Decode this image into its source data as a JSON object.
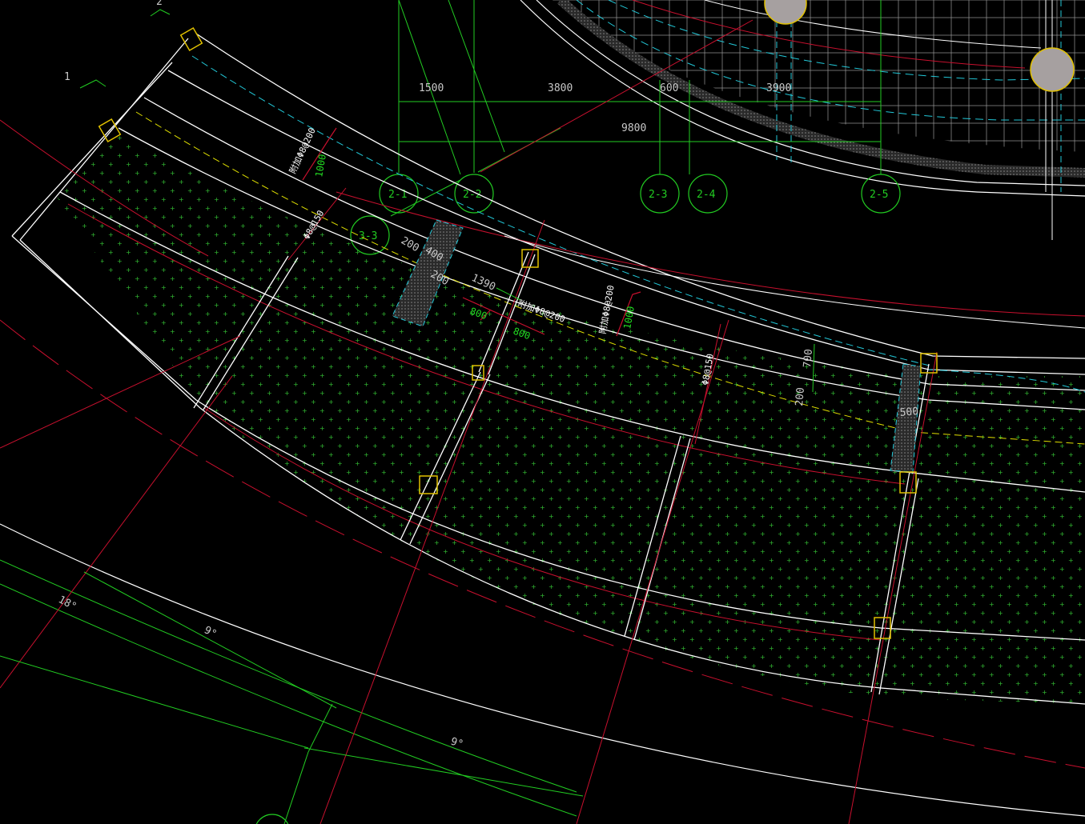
{
  "axes": [
    {
      "id": "2-1"
    },
    {
      "id": "2-2"
    },
    {
      "id": "3-3"
    },
    {
      "id": "2-3"
    },
    {
      "id": "2-4"
    },
    {
      "id": "2-5"
    }
  ],
  "dims": {
    "top": [
      "1500",
      "3800",
      "600",
      "3900"
    ],
    "total": "9800",
    "d200a": "200",
    "d400": "400",
    "d200b": "200",
    "d1390": "1390",
    "d700": "700",
    "d200c": "200",
    "d500": "500"
  },
  "green_dims": {
    "g800a": "800",
    "g800b": "800",
    "g1000a": "1000",
    "g1000b": "1000"
  },
  "rebar": {
    "r1": "附加Φ8@200",
    "r2": "Φ8@150",
    "r3": "附加Φ8@200",
    "r4": "附加Φ8@200",
    "r5": "Φ8@150"
  },
  "angles": {
    "a18": "18°",
    "a9a": "9°",
    "a9b": "9°"
  },
  "marks": {
    "m1": "1",
    "m2": "2"
  },
  "colors": {
    "background": "#000000",
    "green": "#22cc22",
    "red": "#c8102e",
    "white": "#ffffff",
    "cyan": "#22c8d8",
    "yellow": "#e0e000"
  }
}
